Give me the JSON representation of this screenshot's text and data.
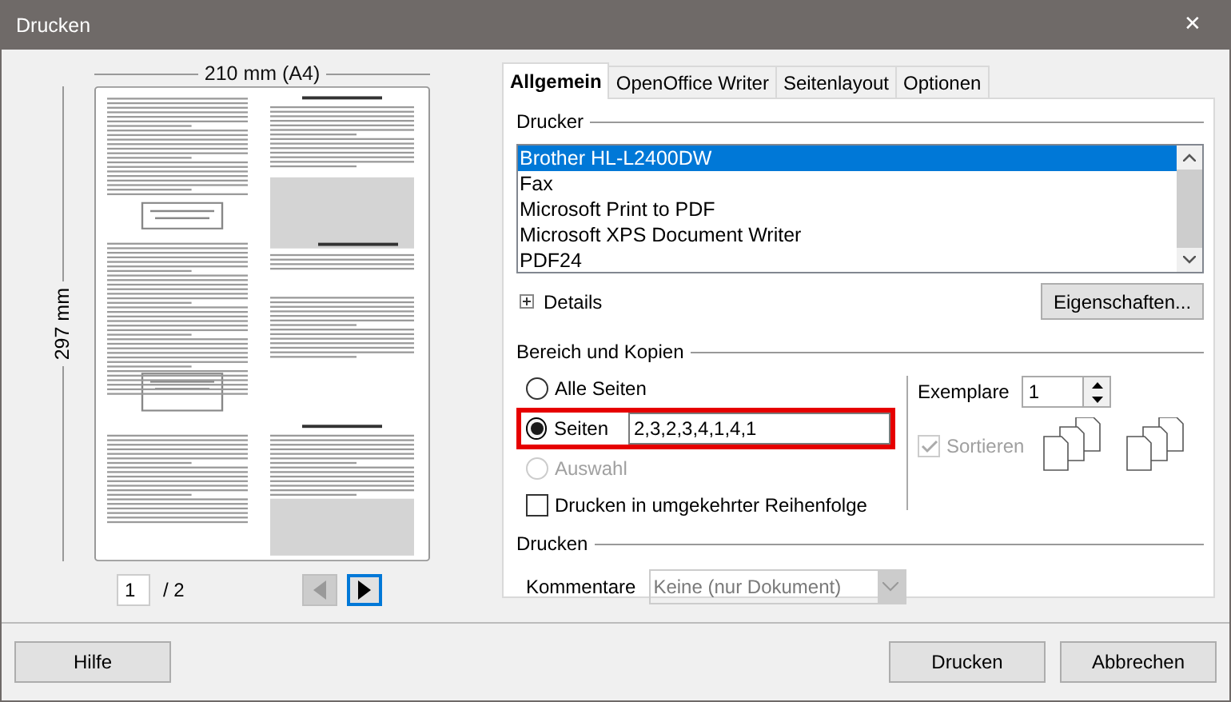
{
  "window": {
    "title": "Drucken",
    "close": "✕"
  },
  "preview": {
    "width_label": "210 mm (A4)",
    "height_label": "297 mm",
    "page": "1",
    "page_count": "/ 2",
    "prev_disabled": true,
    "next_focused": true
  },
  "tabs": [
    {
      "label": "Allgemein",
      "selected": true
    },
    {
      "label": "OpenOffice Writer",
      "selected": false
    },
    {
      "label": "Seitenlayout",
      "selected": false
    },
    {
      "label": "Optionen",
      "selected": false
    }
  ],
  "printer_section": {
    "title": "Drucker",
    "printers": [
      {
        "name": "Brother HL-L2400DW",
        "selected": true
      },
      {
        "name": "Fax",
        "selected": false
      },
      {
        "name": "Microsoft Print to PDF",
        "selected": false
      },
      {
        "name": "Microsoft XPS Document Writer",
        "selected": false
      },
      {
        "name": "PDF24",
        "selected": false
      }
    ],
    "details": {
      "label": "Details",
      "expanded": false
    },
    "properties_button": "Eigenschaften..."
  },
  "range_section": {
    "title": "Bereich und Kopien",
    "options": [
      {
        "label": "Alle Seiten",
        "selected": false,
        "disabled": false,
        "highlighted": false
      },
      {
        "label": "Seiten",
        "selected": true,
        "disabled": false,
        "value": "2,3,2,3,4,1,4,1",
        "highlighted": true
      },
      {
        "label": "Auswahl",
        "selected": false,
        "disabled": true,
        "highlighted": false
      }
    ],
    "reverse": {
      "label": "Drucken in umgekehrter Reihenfolge",
      "checked": false
    },
    "copies_label": "Exemplare",
    "copies": "1",
    "collate": {
      "label": "Sortieren",
      "checked": true,
      "disabled": true
    }
  },
  "print_section": {
    "title": "Drucken",
    "comments_label": "Kommentare",
    "comments_value": "Keine (nur Dokument)",
    "comments_disabled": true
  },
  "buttons": {
    "help": "Hilfe",
    "print": "Drucken",
    "cancel": "Abbrechen"
  }
}
